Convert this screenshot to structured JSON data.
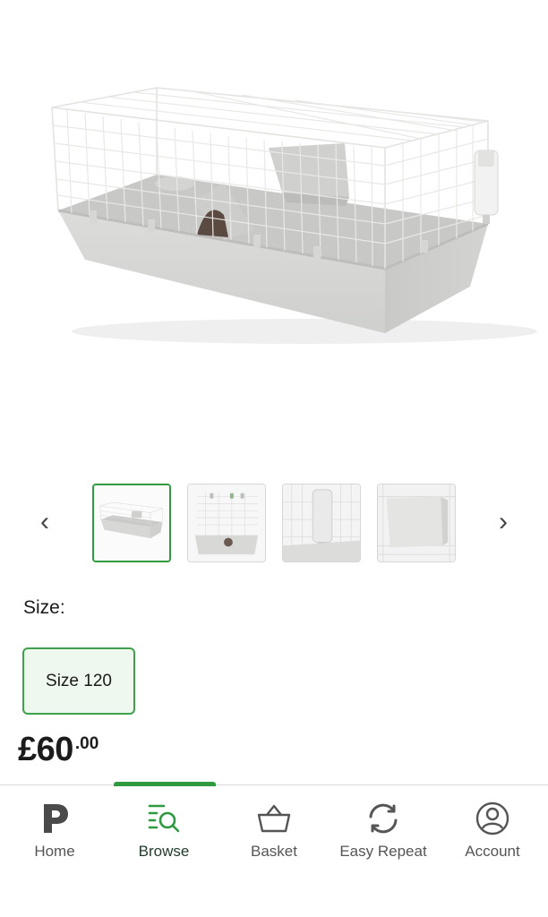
{
  "gallery": {
    "prev_icon": "chevron-left-icon",
    "next_icon": "chevron-right-icon",
    "thumbnails": [
      "thumb-cage-front",
      "thumb-cage-top",
      "thumb-water-bottle",
      "thumb-hay-rack"
    ],
    "active_index": 0
  },
  "size": {
    "label": "Size:",
    "options": [
      "Size 120"
    ],
    "selected": "Size 120"
  },
  "price": {
    "main": "£60",
    "pence": ".00"
  },
  "nav": {
    "items": [
      {
        "label": "Home",
        "icon": "pets-at-home-logo-icon"
      },
      {
        "label": "Browse",
        "icon": "browse-search-icon"
      },
      {
        "label": "Basket",
        "icon": "basket-icon"
      },
      {
        "label": "Easy Repeat",
        "icon": "repeat-icon"
      },
      {
        "label": "Account",
        "icon": "account-icon"
      }
    ],
    "active": "Browse"
  },
  "colors": {
    "accent_green": "#2f9a3f",
    "cage_base": "#d8d9d7",
    "cage_wire": "#eeeeee"
  }
}
